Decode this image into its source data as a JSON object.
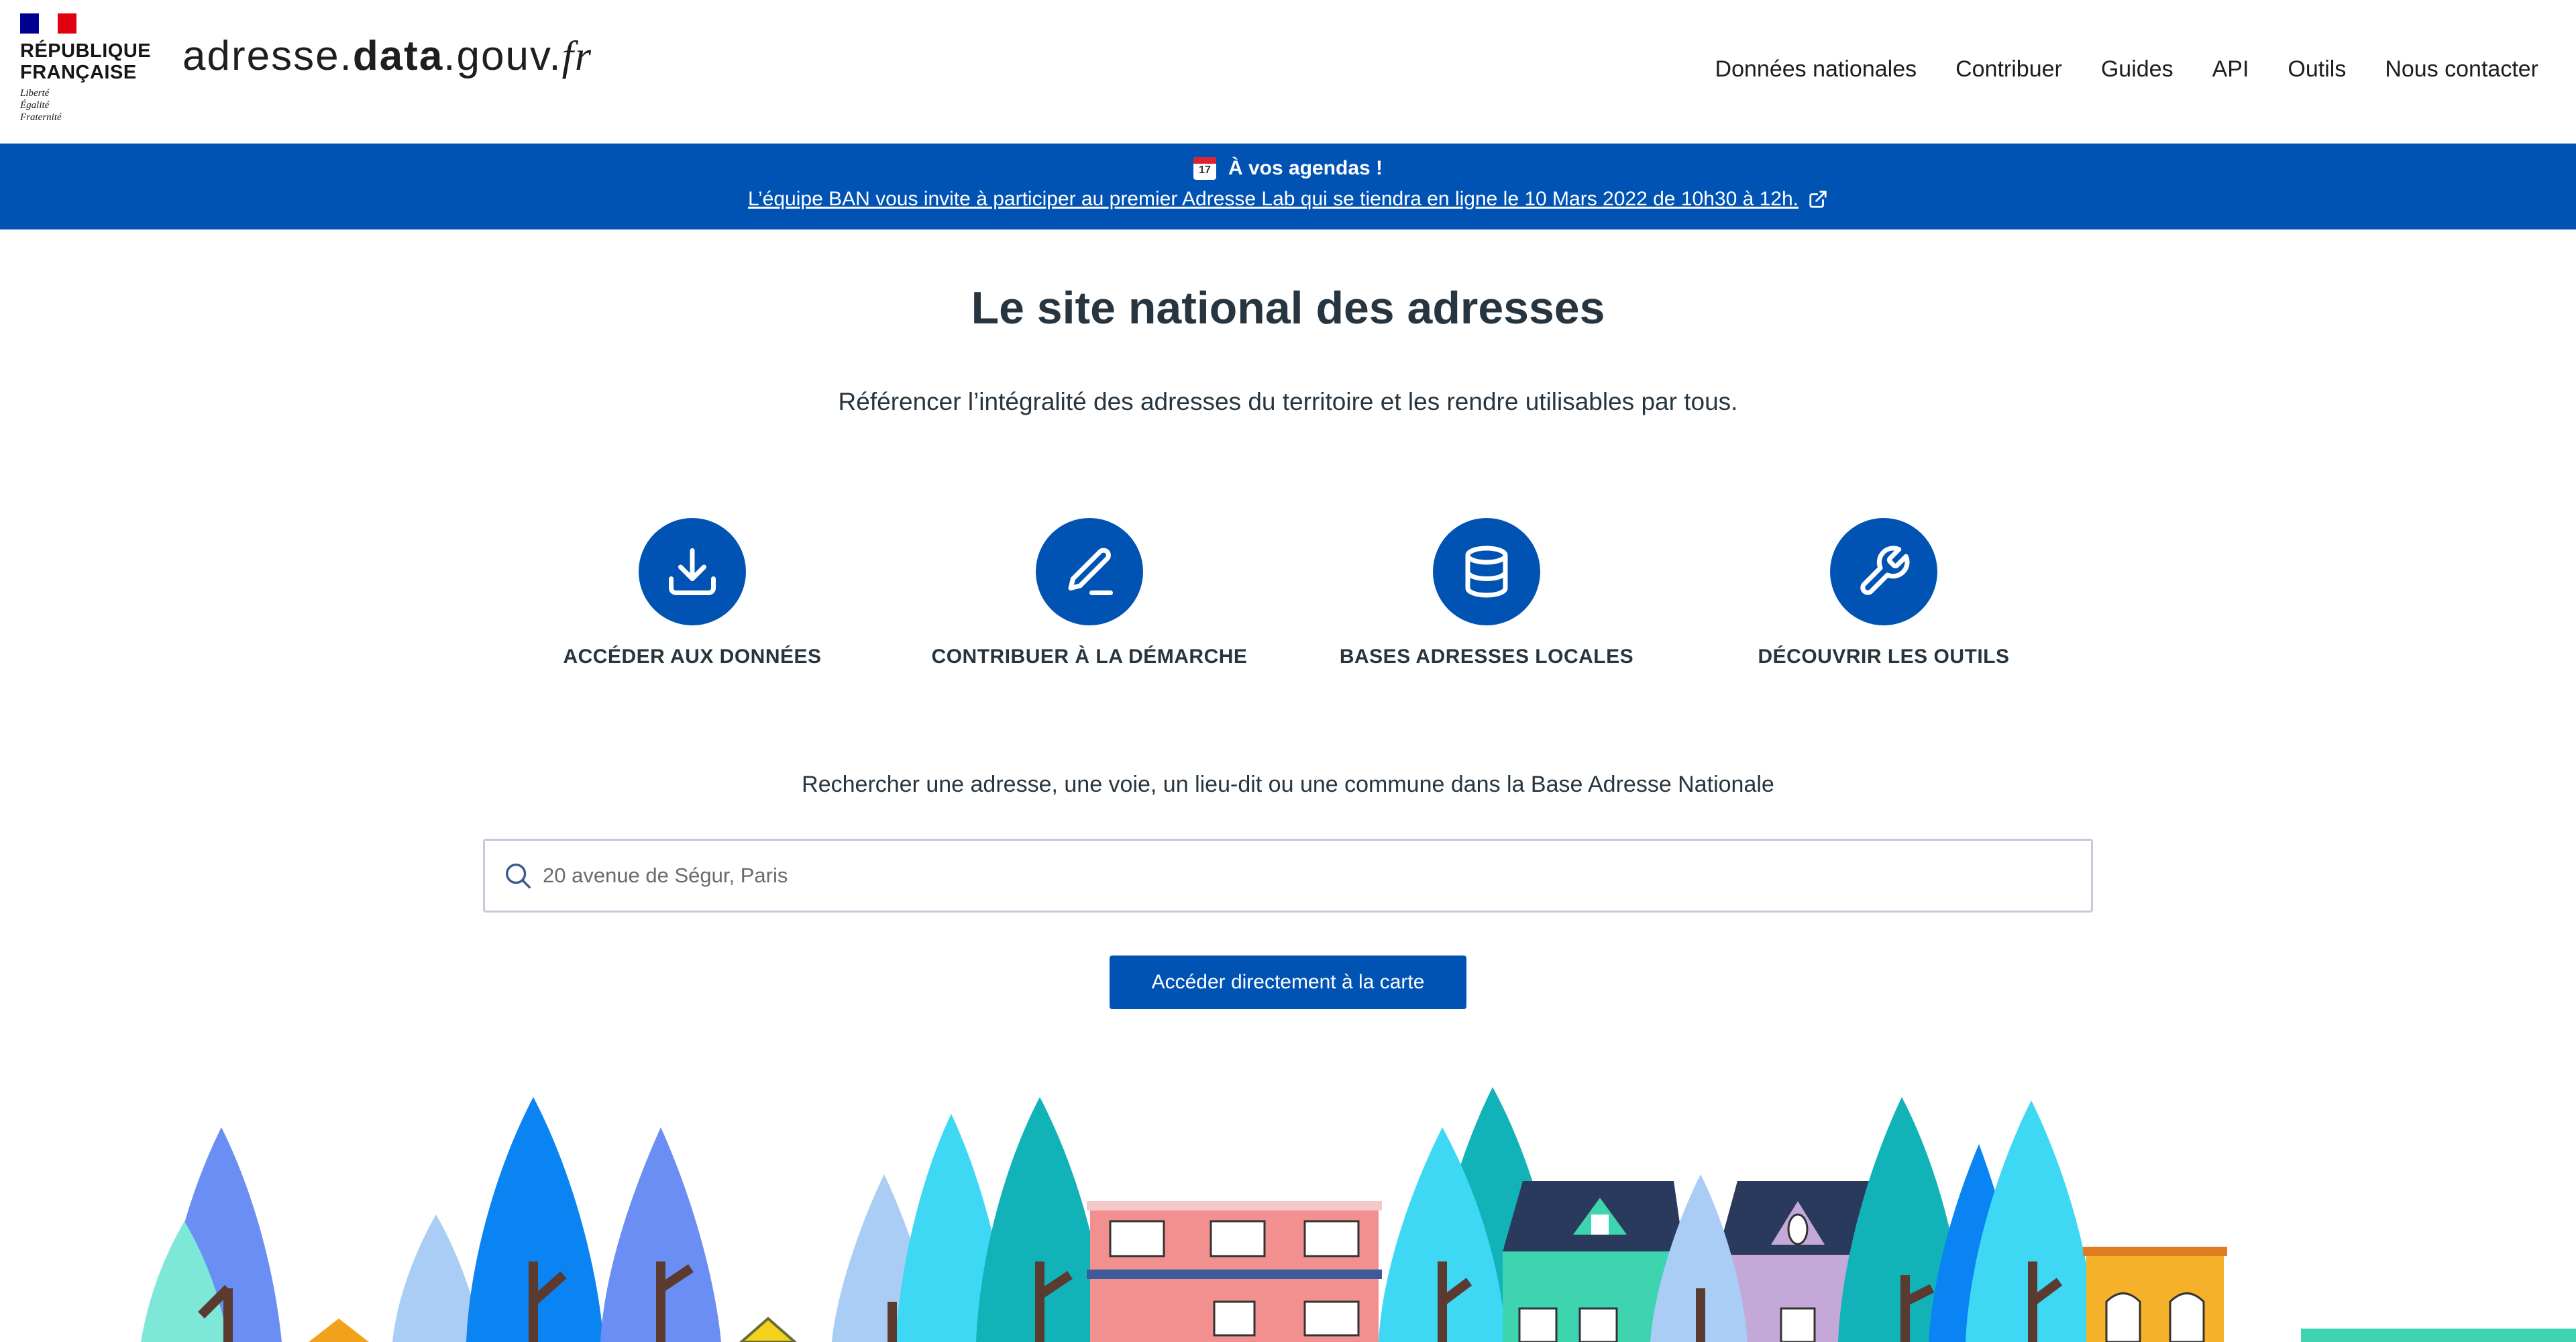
{
  "header": {
    "republic_name": "RÉPUBLIQUE\nFRANÇAISE",
    "motto": "Liberté\nÉgalité\nFraternité",
    "site_title": {
      "part1": "adresse.",
      "part2": "data",
      "part3": ".gouv.",
      "part4": "fr"
    },
    "nav": [
      "Données nationales",
      "Contribuer",
      "Guides",
      "API",
      "Outils",
      "Nous contacter"
    ]
  },
  "banner": {
    "title": "À vos agendas !",
    "link_text": "L’équipe BAN vous invite à participer au premier Adresse Lab qui se tiendra en ligne le 10 Mars 2022 de 10h30 à 12h."
  },
  "hero": {
    "title": "Le site national des adresses",
    "subtitle": "Référencer l’intégralité des adresses du territoire et les rendre utilisables par tous."
  },
  "shortcuts": [
    {
      "label": "ACCÉDER AUX DONNÉES",
      "icon": "download-icon"
    },
    {
      "label": "CONTRIBUER À LA DÉMARCHE",
      "icon": "pencil-icon"
    },
    {
      "label": "BASES ADRESSES LOCALES",
      "icon": "database-icon"
    },
    {
      "label": "DÉCOUVRIR LES OUTILS",
      "icon": "wrench-icon"
    }
  ],
  "search": {
    "hint": "Rechercher une adresse, une voie, un lieu-dit ou une commune dans la Base Adresse Nationale",
    "placeholder": "20 avenue de Ségur, Paris",
    "value": ""
  },
  "map_button": {
    "label": "Accéder directement à la carte"
  },
  "colors": {
    "primary": "#0053b3",
    "heading": "#26353f",
    "flag_blue": "#000091",
    "flag_red": "#e1000f"
  }
}
